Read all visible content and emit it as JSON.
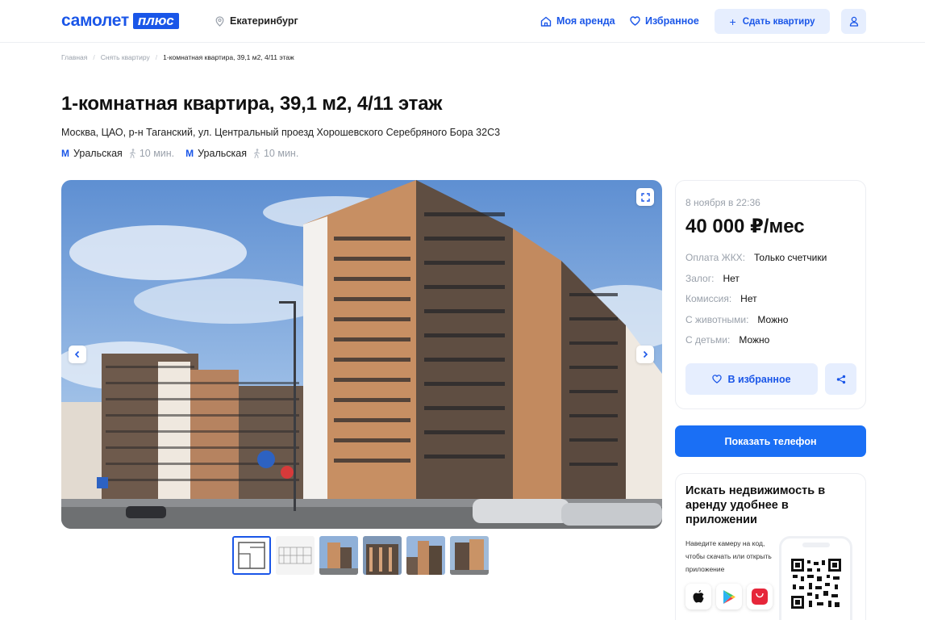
{
  "header": {
    "logo_word": "самолет",
    "logo_badge": "плюс",
    "city": "Екатеринбург",
    "nav_rent": "Моя аренда",
    "nav_favorites": "Избранное",
    "list_button": "Сдать квартиру",
    "icons": [
      "home-icon",
      "heart-icon",
      "plus-icon",
      "user-icon",
      "location-pin-icon"
    ]
  },
  "breadcrumb": {
    "home": "Главная",
    "rent": "Снять квартиру",
    "current": "1-комнатная квартира, 39,1 м2, 4/11 этаж",
    "separator": "/"
  },
  "listing": {
    "title": "1-комнатная квартира, 39,1 м2, 4/11 этаж",
    "address": "Москва, ЦАО, р-н Таганский, ул. Центральный проезд Хорошевского Серебряного Бора 32С3",
    "metro": [
      {
        "logo": "М",
        "name": "Уральская",
        "walk": "10 мин."
      },
      {
        "logo": "М",
        "name": "Уральская",
        "walk": "10 мин."
      }
    ],
    "accent_color": "#1a56e8"
  },
  "gallery": {
    "thumb_count": 6,
    "active_thumb": 0
  },
  "price_card": {
    "date": "8 ноября в 22:36",
    "price": "40 000 ₽/мес",
    "rows": [
      {
        "key": "Оплата ЖКХ:",
        "value": "Только счетчики"
      },
      {
        "key": "Залог:",
        "value": "Нет"
      },
      {
        "key": "Комиссия:",
        "value": "Нет"
      },
      {
        "key": "С животными:",
        "value": "Можно"
      },
      {
        "key": "С детьми:",
        "value": "Можно"
      }
    ],
    "favorite_button": "В избранное"
  },
  "phone_button": "Показать телефон",
  "app_card": {
    "title": "Искать недвижимость в аренду удобнее в приложении",
    "description": "Наведите камеру на код, чтобы скачать или открыть приложение",
    "stores": [
      "apple-store-icon",
      "google-play-icon",
      "huawei-appgallery-icon"
    ]
  }
}
